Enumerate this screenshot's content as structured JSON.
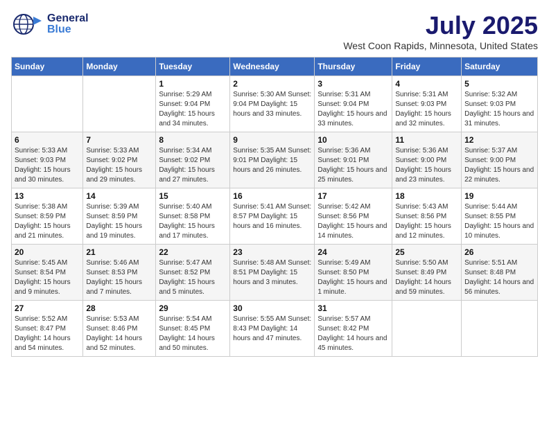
{
  "header": {
    "logo_general": "General",
    "logo_blue": "Blue",
    "title": "July 2025",
    "subtitle": "West Coon Rapids, Minnesota, United States"
  },
  "calendar": {
    "days_of_week": [
      "Sunday",
      "Monday",
      "Tuesday",
      "Wednesday",
      "Thursday",
      "Friday",
      "Saturday"
    ],
    "weeks": [
      [
        {
          "day": "",
          "info": ""
        },
        {
          "day": "",
          "info": ""
        },
        {
          "day": "1",
          "info": "Sunrise: 5:29 AM\nSunset: 9:04 PM\nDaylight: 15 hours and 34 minutes."
        },
        {
          "day": "2",
          "info": "Sunrise: 5:30 AM\nSunset: 9:04 PM\nDaylight: 15 hours and 33 minutes."
        },
        {
          "day": "3",
          "info": "Sunrise: 5:31 AM\nSunset: 9:04 PM\nDaylight: 15 hours and 33 minutes."
        },
        {
          "day": "4",
          "info": "Sunrise: 5:31 AM\nSunset: 9:03 PM\nDaylight: 15 hours and 32 minutes."
        },
        {
          "day": "5",
          "info": "Sunrise: 5:32 AM\nSunset: 9:03 PM\nDaylight: 15 hours and 31 minutes."
        }
      ],
      [
        {
          "day": "6",
          "info": "Sunrise: 5:33 AM\nSunset: 9:03 PM\nDaylight: 15 hours and 30 minutes."
        },
        {
          "day": "7",
          "info": "Sunrise: 5:33 AM\nSunset: 9:02 PM\nDaylight: 15 hours and 29 minutes."
        },
        {
          "day": "8",
          "info": "Sunrise: 5:34 AM\nSunset: 9:02 PM\nDaylight: 15 hours and 27 minutes."
        },
        {
          "day": "9",
          "info": "Sunrise: 5:35 AM\nSunset: 9:01 PM\nDaylight: 15 hours and 26 minutes."
        },
        {
          "day": "10",
          "info": "Sunrise: 5:36 AM\nSunset: 9:01 PM\nDaylight: 15 hours and 25 minutes."
        },
        {
          "day": "11",
          "info": "Sunrise: 5:36 AM\nSunset: 9:00 PM\nDaylight: 15 hours and 23 minutes."
        },
        {
          "day": "12",
          "info": "Sunrise: 5:37 AM\nSunset: 9:00 PM\nDaylight: 15 hours and 22 minutes."
        }
      ],
      [
        {
          "day": "13",
          "info": "Sunrise: 5:38 AM\nSunset: 8:59 PM\nDaylight: 15 hours and 21 minutes."
        },
        {
          "day": "14",
          "info": "Sunrise: 5:39 AM\nSunset: 8:59 PM\nDaylight: 15 hours and 19 minutes."
        },
        {
          "day": "15",
          "info": "Sunrise: 5:40 AM\nSunset: 8:58 PM\nDaylight: 15 hours and 17 minutes."
        },
        {
          "day": "16",
          "info": "Sunrise: 5:41 AM\nSunset: 8:57 PM\nDaylight: 15 hours and 16 minutes."
        },
        {
          "day": "17",
          "info": "Sunrise: 5:42 AM\nSunset: 8:56 PM\nDaylight: 15 hours and 14 minutes."
        },
        {
          "day": "18",
          "info": "Sunrise: 5:43 AM\nSunset: 8:56 PM\nDaylight: 15 hours and 12 minutes."
        },
        {
          "day": "19",
          "info": "Sunrise: 5:44 AM\nSunset: 8:55 PM\nDaylight: 15 hours and 10 minutes."
        }
      ],
      [
        {
          "day": "20",
          "info": "Sunrise: 5:45 AM\nSunset: 8:54 PM\nDaylight: 15 hours and 9 minutes."
        },
        {
          "day": "21",
          "info": "Sunrise: 5:46 AM\nSunset: 8:53 PM\nDaylight: 15 hours and 7 minutes."
        },
        {
          "day": "22",
          "info": "Sunrise: 5:47 AM\nSunset: 8:52 PM\nDaylight: 15 hours and 5 minutes."
        },
        {
          "day": "23",
          "info": "Sunrise: 5:48 AM\nSunset: 8:51 PM\nDaylight: 15 hours and 3 minutes."
        },
        {
          "day": "24",
          "info": "Sunrise: 5:49 AM\nSunset: 8:50 PM\nDaylight: 15 hours and 1 minute."
        },
        {
          "day": "25",
          "info": "Sunrise: 5:50 AM\nSunset: 8:49 PM\nDaylight: 14 hours and 59 minutes."
        },
        {
          "day": "26",
          "info": "Sunrise: 5:51 AM\nSunset: 8:48 PM\nDaylight: 14 hours and 56 minutes."
        }
      ],
      [
        {
          "day": "27",
          "info": "Sunrise: 5:52 AM\nSunset: 8:47 PM\nDaylight: 14 hours and 54 minutes."
        },
        {
          "day": "28",
          "info": "Sunrise: 5:53 AM\nSunset: 8:46 PM\nDaylight: 14 hours and 52 minutes."
        },
        {
          "day": "29",
          "info": "Sunrise: 5:54 AM\nSunset: 8:45 PM\nDaylight: 14 hours and 50 minutes."
        },
        {
          "day": "30",
          "info": "Sunrise: 5:55 AM\nSunset: 8:43 PM\nDaylight: 14 hours and 47 minutes."
        },
        {
          "day": "31",
          "info": "Sunrise: 5:57 AM\nSunset: 8:42 PM\nDaylight: 14 hours and 45 minutes."
        },
        {
          "day": "",
          "info": ""
        },
        {
          "day": "",
          "info": ""
        }
      ]
    ]
  }
}
